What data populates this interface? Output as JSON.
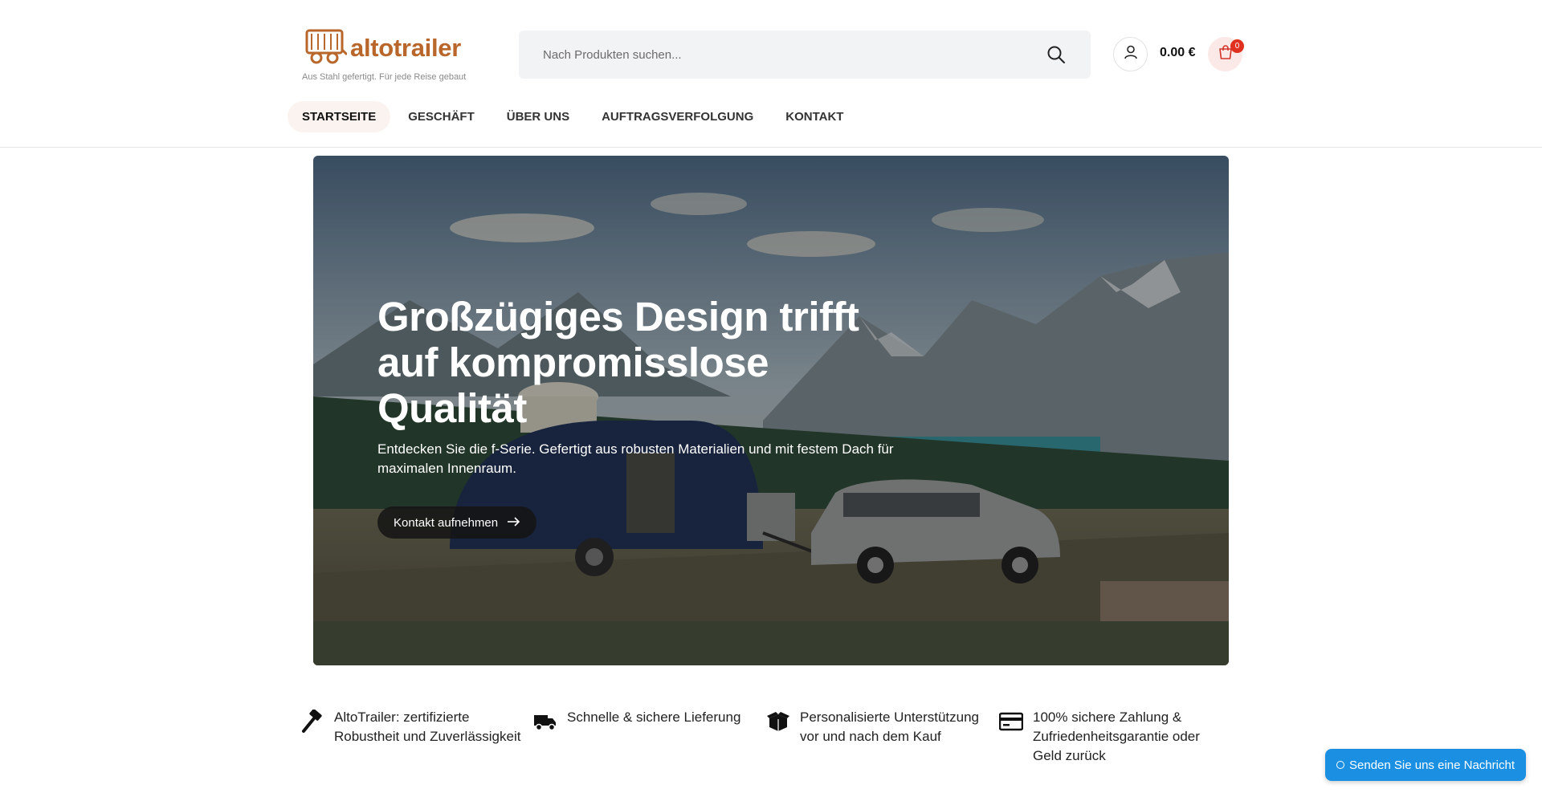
{
  "header": {
    "logo_text": "altotrailer",
    "tagline": "Aus Stahl gefertigt. Für jede Reise gebaut",
    "search": {
      "placeholder": "Nach Produkten suchen..."
    },
    "cart_total": "0.00 €",
    "cart_count": "0",
    "icons": {
      "search": "search-icon",
      "account": "user-icon",
      "cart": "shopping-bag-icon",
      "logo": "trailer-icon"
    }
  },
  "nav": {
    "items": [
      {
        "label": "STARTSEITE",
        "active": true
      },
      {
        "label": "GESCHÄFT",
        "active": false
      },
      {
        "label": "ÜBER UNS",
        "active": false
      },
      {
        "label": "AUFTRAGSVERFOLGUNG",
        "active": false
      },
      {
        "label": "KONTAKT",
        "active": false
      }
    ]
  },
  "hero": {
    "title": "Großzügiges Design trifft auf kompromisslose Qualität",
    "subtitle": "Entdecken Sie die f-Serie. Gefertigt aus robusten Materialien und mit festem Dach für maximalen Innenraum.",
    "cta_label": "Kontakt aufnehmen",
    "cta_icon": "arrow-right-icon"
  },
  "features": [
    {
      "icon": "hammer-icon",
      "text": "AltoTrailer: zertifizierte Robustheit und Zuverlässigkeit"
    },
    {
      "icon": "truck-icon",
      "text": "Schnelle & sichere Lieferung"
    },
    {
      "icon": "box-icon",
      "text": "Personalisierte Unterstützung vor und nach dem Kauf"
    },
    {
      "icon": "credit-card-icon",
      "text": "100% sichere Zahlung & Zufriedenheitsgarantie oder Geld zurück"
    }
  ],
  "chat": {
    "label": "Senden Sie uns eine Nachricht"
  },
  "colors": {
    "brand": "#b8662a",
    "cart_badge": "#e0301e",
    "chat": "#1b8fe2"
  }
}
